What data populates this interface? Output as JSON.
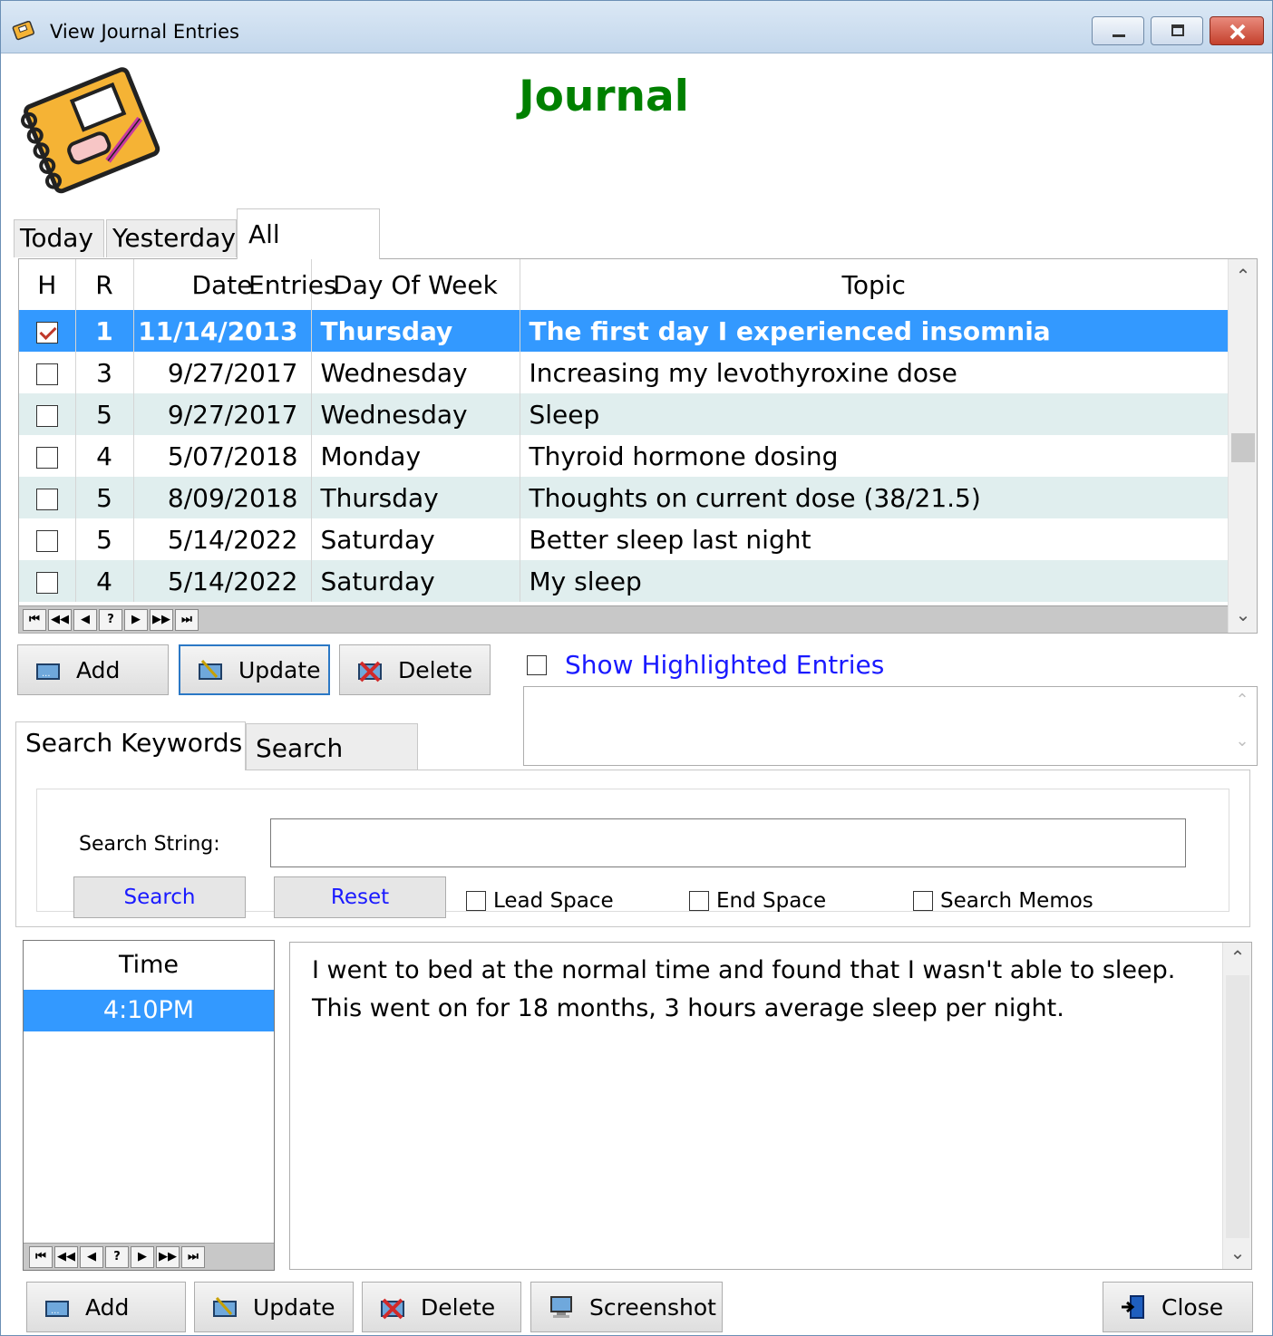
{
  "window": {
    "title": "View Journal Entries"
  },
  "page": {
    "title": "Journal"
  },
  "tabs": [
    {
      "label": "Today",
      "active": false
    },
    {
      "label": "Yesterday",
      "active": false
    },
    {
      "label": "All Entries",
      "active": true
    }
  ],
  "grid": {
    "columns": [
      "H",
      "R",
      "Date",
      "Day Of Week",
      "Topic"
    ],
    "rows": [
      {
        "h": true,
        "r": "1",
        "date": "11/14/2013",
        "dow": "Thursday",
        "topic": "The first day I experienced insomnia",
        "selected": true
      },
      {
        "h": false,
        "r": "3",
        "date": "9/27/2017",
        "dow": "Wednesday",
        "topic": "Increasing my levothyroxine dose"
      },
      {
        "h": false,
        "r": "5",
        "date": "9/27/2017",
        "dow": "Wednesday",
        "topic": "Sleep"
      },
      {
        "h": false,
        "r": "4",
        "date": "5/07/2018",
        "dow": "Monday",
        "topic": "Thyroid hormone dosing"
      },
      {
        "h": false,
        "r": "5",
        "date": "8/09/2018",
        "dow": "Thursday",
        "topic": "Thoughts on current dose (38/21.5)"
      },
      {
        "h": false,
        "r": "5",
        "date": "5/14/2022",
        "dow": "Saturday",
        "topic": "Better sleep last night"
      },
      {
        "h": false,
        "r": "4",
        "date": "5/14/2022",
        "dow": "Saturday",
        "topic": "My sleep"
      }
    ],
    "navigator": [
      "⏮",
      "◀◀",
      "◀",
      "?",
      "▶",
      "▶▶",
      "⏭"
    ]
  },
  "entry_buttons": {
    "add": "Add",
    "update": "Update",
    "delete": "Delete"
  },
  "show_highlighted": {
    "label": "Show Highlighted Entries",
    "checked": false
  },
  "search_tabs": [
    {
      "label": "Search Keywords",
      "active": true
    },
    {
      "label": "Search Notes",
      "active": false
    }
  ],
  "search": {
    "label": "Search String:",
    "value": "",
    "search_button": "Search",
    "reset_button": "Reset",
    "options": [
      {
        "label": "Lead Space",
        "checked": false
      },
      {
        "label": "End Space",
        "checked": false
      },
      {
        "label": "Search Memos",
        "checked": false
      }
    ]
  },
  "time_list": {
    "header": "Time",
    "items": [
      "4:10PM"
    ]
  },
  "memo": {
    "text": "I went to bed at the normal time and found that I wasn't able to sleep. This went on for 18 months, 3 hours average sleep per night."
  },
  "bottom_buttons": {
    "add": "Add",
    "update": "Update",
    "delete": "Delete",
    "screenshot": "Screenshot",
    "close": "Close"
  },
  "colors": {
    "title_green": "#008000",
    "selection_blue": "#3399ff",
    "alt_row": "#e0eeee",
    "link_blue": "#1a1aff"
  }
}
